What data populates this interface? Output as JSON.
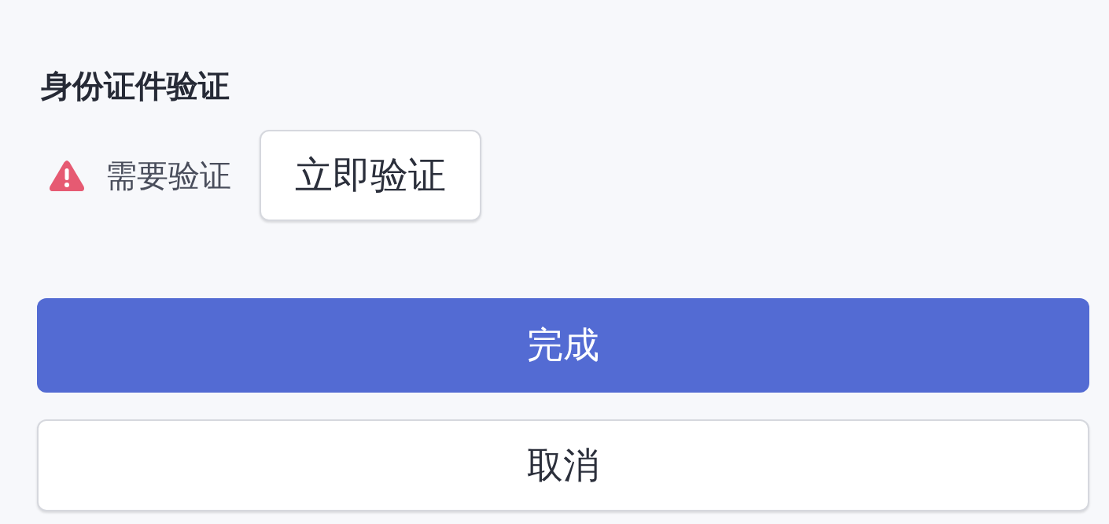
{
  "verification": {
    "title": "身份证件验证",
    "status": {
      "kind": "warning",
      "label": "需要验证"
    },
    "action": "立即验证"
  },
  "buttons": [
    {
      "label": "完成",
      "kind": "primary"
    },
    {
      "label": "取消",
      "kind": "secondary"
    }
  ]
}
